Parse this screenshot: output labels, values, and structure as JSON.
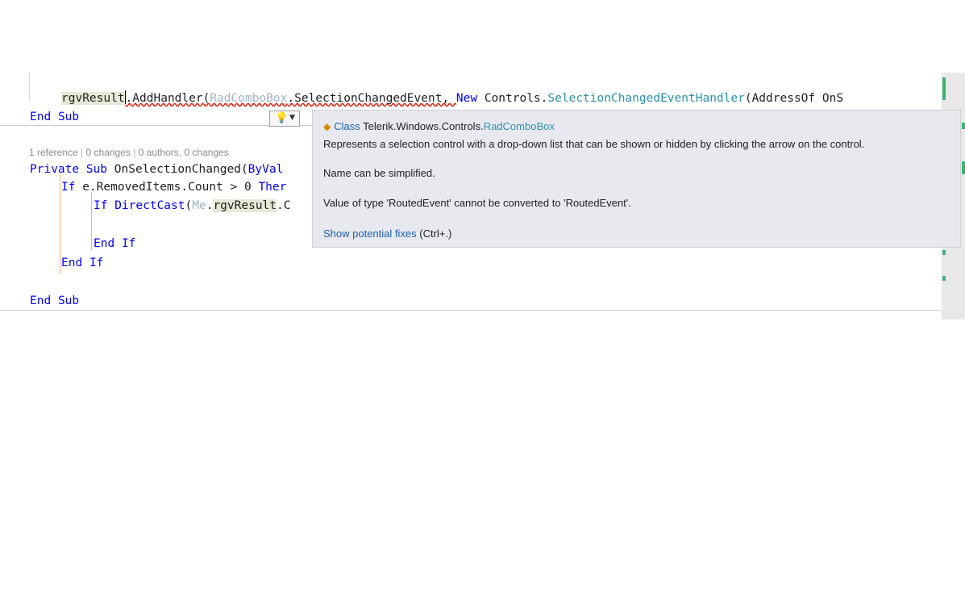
{
  "editor": {
    "line1": {
      "ident": "rgvResult",
      "after_ident": ".AddHandler(",
      "faded_type": "RadComboBox",
      "event": ".SelectionChangedEvent, ",
      "new_kw": "New",
      "controls": " Controls.",
      "handler_type": "SelectionChangedEventHandler",
      "addressof": "(AddressOf OnS"
    },
    "line2": {
      "end_kw": "End",
      "sub_kw": "Sub"
    },
    "codelens": {
      "references": "1 reference",
      "changes": "0 changes",
      "authors": "0 authors, 0 changes",
      "separator": "|"
    },
    "line3": {
      "private_kw": "Private",
      "sub_kw": "Sub",
      "rest": " OnSelectionChanged(",
      "byval": "ByVal"
    },
    "line4": {
      "if_kw": "If",
      "rest": " e.RemovedItems.Count > 0 ",
      "then_kw": "Ther"
    },
    "line5": {
      "if_kw": "If",
      "directcast": "DirectCast",
      "paren": "(",
      "me_kw": "Me",
      "dot": ".",
      "ident": "rgvResult",
      "rest": ".C"
    },
    "line6": {
      "end_kw": "End",
      "if_kw": "If"
    },
    "line7": {
      "end_kw": "End",
      "if_kw": "If"
    },
    "line8": {
      "end_kw": "End",
      "sub_kw": "Sub"
    }
  },
  "lightbulb": {
    "icon": "lightbulb-icon",
    "dropdown_icon": "chevron-down-icon"
  },
  "tooltip": {
    "class_icon": "class-icon",
    "class_label": "Class",
    "namespace": "Telerik.Windows.Controls.",
    "type_name": "RadComboBox",
    "description": "Represents a selection control with a drop-down list that can be shown or hidden by clicking the arrow on the control.",
    "diagnostic1": "Name can be simplified.",
    "diagnostic2": "Value of type 'RoutedEvent' cannot be converted to 'RoutedEvent'.",
    "fix_link": "Show potential fixes",
    "fix_shortcut": " (Ctrl+.)"
  },
  "colors": {
    "keyword": "#0000ff",
    "type": "#2b91af",
    "error": "#e51400",
    "tooltip_bg": "#e8e9ee"
  }
}
